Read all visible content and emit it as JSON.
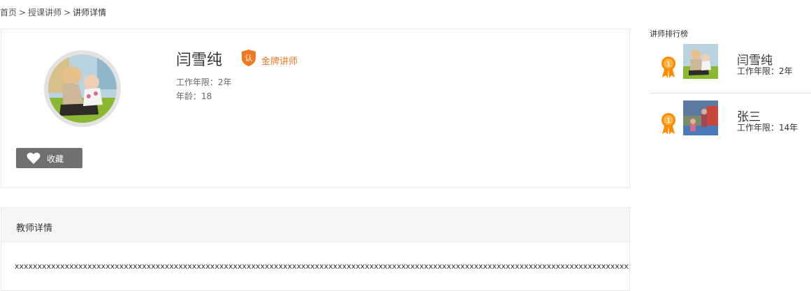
{
  "breadcrumb": {
    "home": "首页",
    "sep": ">",
    "teachers": "授课讲师",
    "current": "讲师详情"
  },
  "profile": {
    "name": "闫雪纯",
    "badge_char": "认",
    "badge_label": "金牌讲师",
    "years_label": "工作年限：",
    "years_value": "2年",
    "age_label": "年龄：",
    "age_value": "18",
    "favorite_label": "收藏"
  },
  "detail": {
    "title": "教师详情",
    "body": "xxxxxxxxxxxxxxxxxxxxxxxxxxxxxxxxxxxxxxxxxxxxxxxxxxxxxxxxxxxxxxxxxxxxxxxxxxxxxxxxxxxxxxxxxxxxxxxxxxxxxxxxxxxxxxxxxxxxxxxxxxxxxxxxxxxxxxxxxxx"
  },
  "ranking": {
    "title": "讲师排行榜",
    "items": [
      {
        "rank": "1",
        "name": "闫雪纯",
        "years": "工作年限：2年"
      },
      {
        "rank": "1",
        "name": "张三",
        "years": "工作年限：14年"
      }
    ]
  },
  "colors": {
    "accent": "#f07a22",
    "medal": "#ff8c00",
    "button": "#707070"
  }
}
